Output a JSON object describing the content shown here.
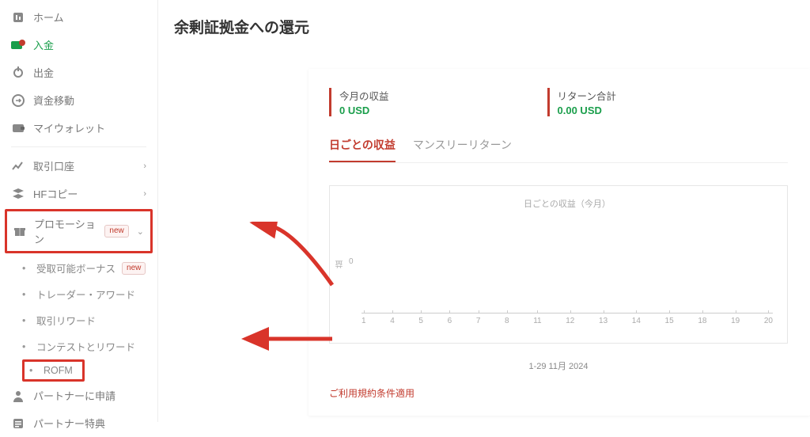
{
  "sidebar": {
    "items": [
      {
        "label": "ホーム",
        "icon": "home"
      },
      {
        "label": "入金",
        "icon": "deposit",
        "active": true
      },
      {
        "label": "出金",
        "icon": "withdraw"
      },
      {
        "label": "資金移動",
        "icon": "transfer"
      },
      {
        "label": "マイウォレット",
        "icon": "wallet"
      }
    ],
    "items2": [
      {
        "label": "取引口座",
        "icon": "chart",
        "chevron": true
      },
      {
        "label": "HFコピー",
        "icon": "layers",
        "chevron": true
      }
    ],
    "promotion": {
      "label": "プロモーション",
      "badge": "new"
    },
    "sub_items": [
      {
        "label": "受取可能ボーナス",
        "badge": "new"
      },
      {
        "label": "トレーダー・アワード"
      },
      {
        "label": "取引リワード"
      },
      {
        "label": "コンテストとリワード"
      },
      {
        "label": "ROFM",
        "highlight": true
      }
    ],
    "bottom": [
      {
        "label": "パートナーに申請",
        "icon": "user"
      },
      {
        "label": "パートナー特典",
        "icon": "list"
      }
    ]
  },
  "page": {
    "title": "余剰証拠金への還元",
    "stats": [
      {
        "label": "今月の収益",
        "value": "0 USD"
      },
      {
        "label": "リターン合計",
        "value": "0.00 USD"
      }
    ],
    "tabs": [
      {
        "label": "日ごとの収益",
        "active": true
      },
      {
        "label": "マンスリーリターン"
      }
    ],
    "terms": "ご利用規約条件適用"
  },
  "chart_data": {
    "type": "bar",
    "title": "日ごとの収益（今月）",
    "ylabel": "益",
    "ytick": "0",
    "x_caption": "1-29 11月 2024",
    "categories": [
      "1",
      "4",
      "5",
      "6",
      "7",
      "8",
      "11",
      "12",
      "13",
      "14",
      "15",
      "18",
      "19",
      "20"
    ],
    "values": [
      0,
      0,
      0,
      0,
      0,
      0,
      0,
      0,
      0,
      0,
      0,
      0,
      0,
      0
    ],
    "ylim": [
      0,
      1
    ]
  }
}
